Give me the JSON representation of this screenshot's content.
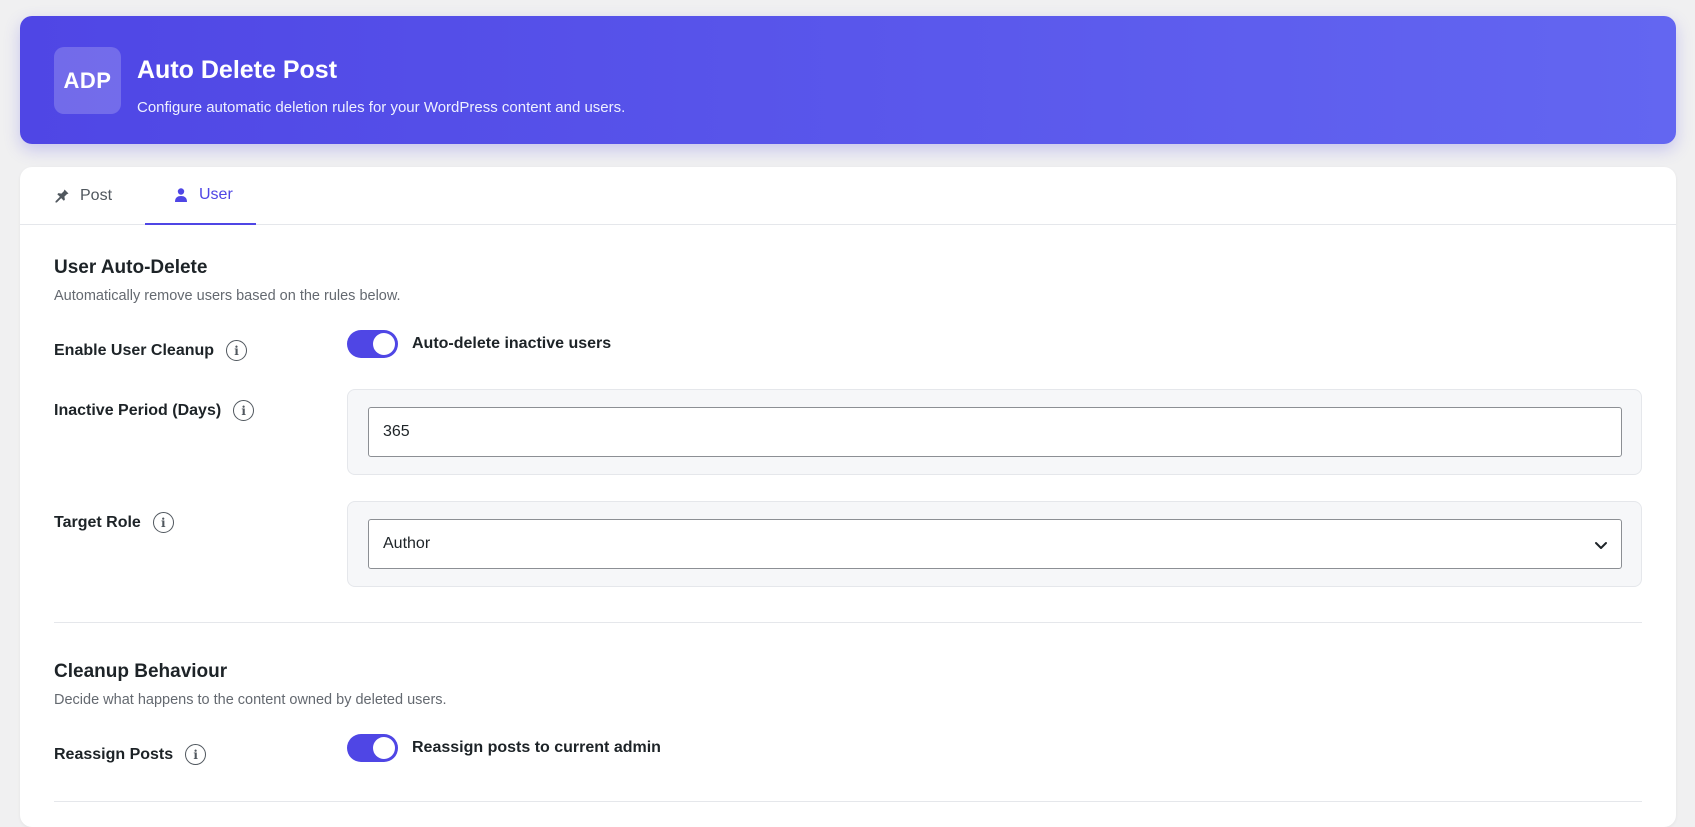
{
  "header": {
    "logo_text": "ADP",
    "title": "Auto Delete Post",
    "subtitle": "Configure automatic deletion rules for your WordPress content and users."
  },
  "tabs": [
    {
      "label": "Post",
      "icon": "pin-icon",
      "active": false
    },
    {
      "label": "User",
      "icon": "user-icon",
      "active": true
    }
  ],
  "user_section": {
    "title": "User Auto-Delete",
    "description": "Automatically remove users based on the rules below.",
    "enable_label": "Enable User Cleanup",
    "enable_toggle_text": "Auto-delete inactive users",
    "enable_on": true,
    "inactive_label": "Inactive Period (Days)",
    "inactive_value": "365",
    "role_label": "Target Role",
    "role_value": "Author"
  },
  "cleanup_section": {
    "title": "Cleanup Behaviour",
    "description": "Decide what happens to the content owned by deleted users.",
    "reassign_label": "Reassign Posts",
    "reassign_toggle_text": "Reassign posts to current admin",
    "reassign_on": true
  },
  "colors": {
    "accent": "#4f46e5",
    "header_gradient_end": "#6366f1"
  }
}
